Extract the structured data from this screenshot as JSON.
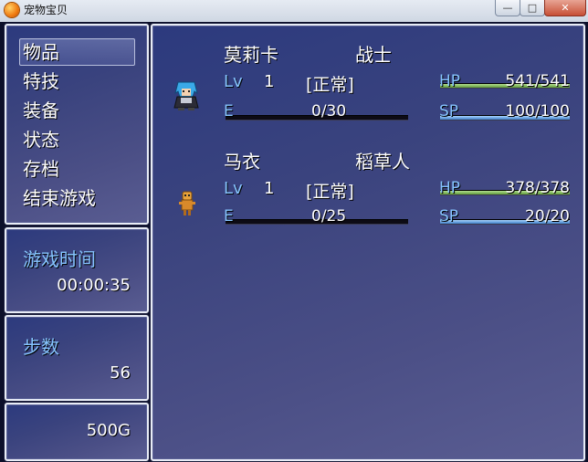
{
  "window": {
    "title": "宠物宝贝",
    "minimize_glyph": "—",
    "maximize_glyph": "□",
    "close_glyph": "✕"
  },
  "menu": {
    "items": [
      {
        "label": "物品"
      },
      {
        "label": "特技"
      },
      {
        "label": "装备"
      },
      {
        "label": "状态"
      },
      {
        "label": "存档"
      },
      {
        "label": "结束游戏"
      }
    ],
    "selected_index": 0
  },
  "playtime": {
    "label": "游戏时间",
    "value": "00:00:35"
  },
  "steps": {
    "label": "步数",
    "value": "56"
  },
  "gold": {
    "value": "500G"
  },
  "party": [
    {
      "name": "莫莉卡",
      "class": "战士",
      "lv_label": "Lv",
      "level": "1",
      "state": "[正常]",
      "exp_label": "E",
      "exp": "0/30",
      "exp_ratio": 0,
      "hp_label": "HP",
      "hp": "541/541",
      "hp_ratio": 1.0,
      "sp_label": "SP",
      "sp": "100/100",
      "sp_ratio": 1.0,
      "sprite": "blue-haired-warrior-sprite"
    },
    {
      "name": "马衣",
      "class": "稻草人",
      "lv_label": "Lv",
      "level": "1",
      "state": "[正常]",
      "exp_label": "E",
      "exp": "0/25",
      "exp_ratio": 0,
      "hp_label": "HP",
      "hp": "378/378",
      "hp_ratio": 1.0,
      "sp_label": "SP",
      "sp": "20/20",
      "sp_ratio": 1.0,
      "sprite": "scarecrow-sprite"
    }
  ]
}
